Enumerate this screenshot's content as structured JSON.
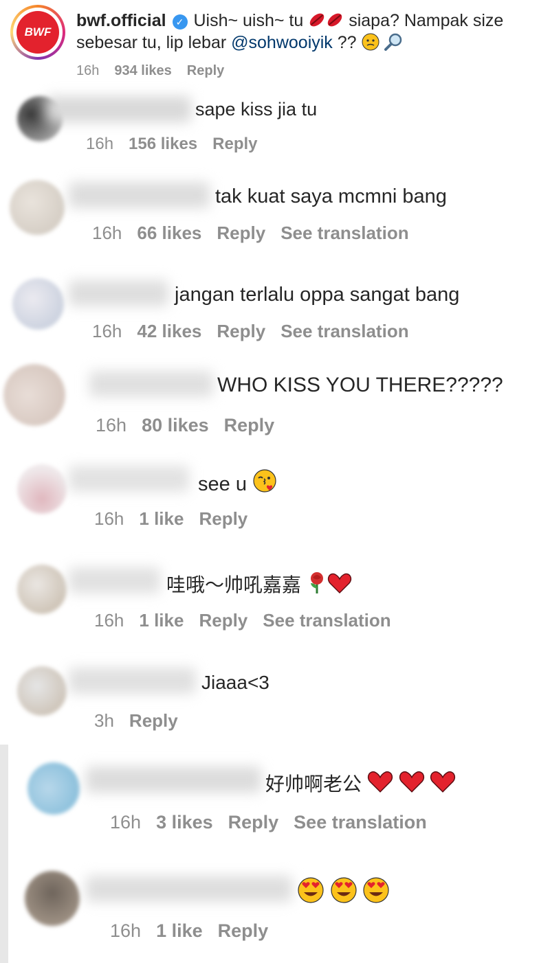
{
  "post": {
    "logo_text": "BWF",
    "username": "bwf.official",
    "caption_line1_pre": "Uish~ uish~ tu",
    "caption_line1_post": "siapa? Nampak size",
    "caption_line2_pre": "sebesar tu, lip lebar",
    "mention": "@sohwooiyik",
    "caption_line2_post": "??",
    "time": "16h",
    "likes": "934 likes",
    "reply": "Reply"
  },
  "comments": [
    {
      "text": "sape kiss jia tu",
      "time": "16h",
      "likes": "156 likes",
      "reply": "Reply"
    },
    {
      "text": "tak kuat saya mcmni bang",
      "time": "16h",
      "likes": "66 likes",
      "reply": "Reply",
      "translate": "See translation"
    },
    {
      "text": "jangan terlalu oppa sangat bang",
      "time": "16h",
      "likes": "42 likes",
      "reply": "Reply",
      "translate": "See translation"
    },
    {
      "text": "WHO KISS YOU THERE?????",
      "time": "16h",
      "likes": "80 likes",
      "reply": "Reply"
    },
    {
      "text": "see u",
      "time": "16h",
      "likes": "1 like",
      "reply": "Reply"
    },
    {
      "text": "哇哦～帅吼嘉嘉",
      "time": "16h",
      "likes": "1 like",
      "reply": "Reply",
      "translate": "See translation"
    },
    {
      "text": "Jiaaa<3",
      "time": "3h",
      "reply": "Reply"
    },
    {
      "text": "好帅啊老公",
      "time": "16h",
      "likes": "3 likes",
      "reply": "Reply",
      "translate": "See translation"
    },
    {
      "text": "",
      "time": "16h",
      "likes": "1 like",
      "reply": "Reply"
    }
  ],
  "icons": [
    "verified-badge-icon",
    "lips-emoji",
    "confused-face-emoji",
    "magnifier-emoji",
    "kiss-face-emoji",
    "rose-emoji",
    "heart-emoji",
    "heart-eyes-emoji"
  ]
}
